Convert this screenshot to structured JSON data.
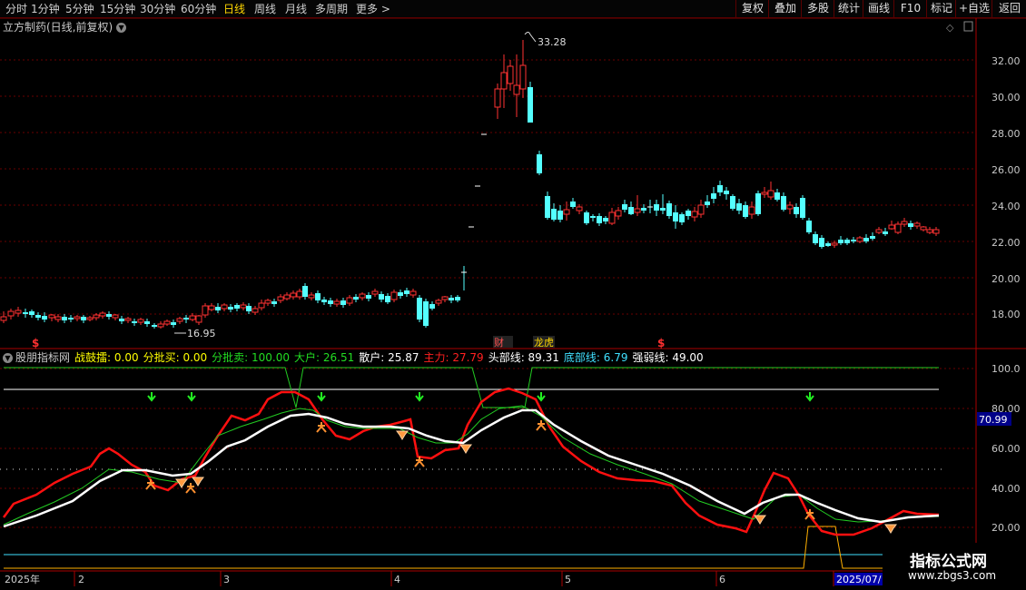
{
  "toolbar": {
    "periods": [
      "分时",
      "1分钟",
      "5分钟",
      "15分钟",
      "30分钟",
      "60分钟",
      "日线",
      "周线",
      "月线",
      "多周期",
      "更多 >"
    ],
    "active_period": "日线",
    "right_buttons": [
      "复权",
      "叠加",
      "多股",
      "统计",
      "画线",
      "F10",
      "标记",
      "+自选",
      "返回"
    ]
  },
  "main_chart": {
    "title": "立方制药(日线,前复权)",
    "high_marker": "33.28",
    "low_marker": "16.95",
    "y_ticks": [
      "32.00",
      "30.00",
      "28.00",
      "26.00",
      "24.00",
      "22.00",
      "20.00",
      "18.00"
    ],
    "event_tags": [
      "$",
      "财",
      "龙虎",
      "$"
    ]
  },
  "indicator": {
    "name": "股朋指标网",
    "items": [
      {
        "label": "战鼓擂: 0.00",
        "color": "#ffff00"
      },
      {
        "label": "分批买: 0.00",
        "color": "#ffff00"
      },
      {
        "label": "分批卖: 100.00",
        "color": "#22dd22"
      },
      {
        "label": "大户: 26.51",
        "color": "#22dd22"
      },
      {
        "label": "散户: 25.87",
        "color": "#ffffff"
      },
      {
        "label": "主力: 27.79",
        "color": "#ff2020"
      },
      {
        "label": "头部线: 89.31",
        "color": "#ffffff"
      },
      {
        "label": "底部线: 6.79",
        "color": "#40e0ff"
      },
      {
        "label": "强弱线: 49.00",
        "color": "#ffffff"
      }
    ],
    "y_ticks": [
      "100.0",
      "80.00",
      "60.00",
      "40.00",
      "20.00"
    ],
    "current_value": "70.99"
  },
  "x_axis": {
    "labels": [
      "2025年",
      "2",
      "3",
      "4",
      "5",
      "6",
      "2025/07/"
    ]
  },
  "watermark": {
    "line1": "指标公式网",
    "line2": "www.zbgs3.com"
  },
  "colors": {
    "up": "#ff3232",
    "down": "#54ffff",
    "grid": "#7a0000",
    "accent": "#ffd700"
  }
}
